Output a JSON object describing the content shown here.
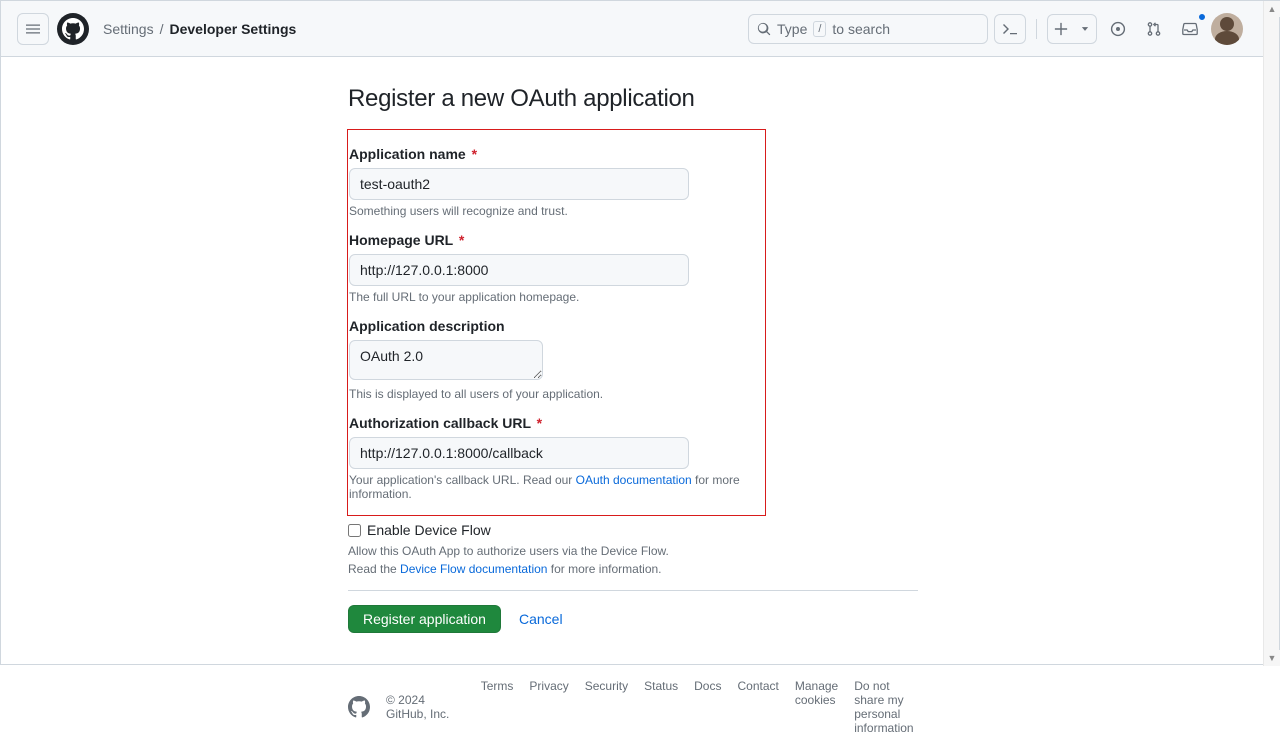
{
  "header": {
    "breadcrumb": {
      "settings": "Settings",
      "dev": "Developer Settings"
    },
    "search": {
      "prefix": "Type",
      "kbd": "/",
      "suffix": "to search"
    }
  },
  "page": {
    "title": "Register a new OAuth application"
  },
  "form": {
    "app_name": {
      "label": "Application name",
      "value": "test-oauth2",
      "help": "Something users will recognize and trust."
    },
    "homepage": {
      "label": "Homepage URL",
      "value": "http://127.0.0.1:8000",
      "help": "The full URL to your application homepage."
    },
    "description": {
      "label": "Application description",
      "value": "OAuth 2.0",
      "help": "This is displayed to all users of your application."
    },
    "callback": {
      "label": "Authorization callback URL",
      "value": "http://127.0.0.1:8000/callback",
      "help_prefix": "Your application's callback URL. Read our ",
      "help_link": "OAuth documentation",
      "help_suffix": " for more information."
    },
    "device_flow": {
      "label": "Enable Device Flow",
      "help1": "Allow this OAuth App to authorize users via the Device Flow.",
      "help2_prefix": "Read the ",
      "help2_link": "Device Flow documentation",
      "help2_suffix": " for more information."
    },
    "actions": {
      "submit": "Register application",
      "cancel": "Cancel"
    }
  },
  "footer": {
    "copyright": "© 2024 GitHub, Inc.",
    "links": [
      "Terms",
      "Privacy",
      "Security",
      "Status",
      "Docs",
      "Contact",
      "Manage cookies",
      "Do not share my personal information"
    ]
  }
}
